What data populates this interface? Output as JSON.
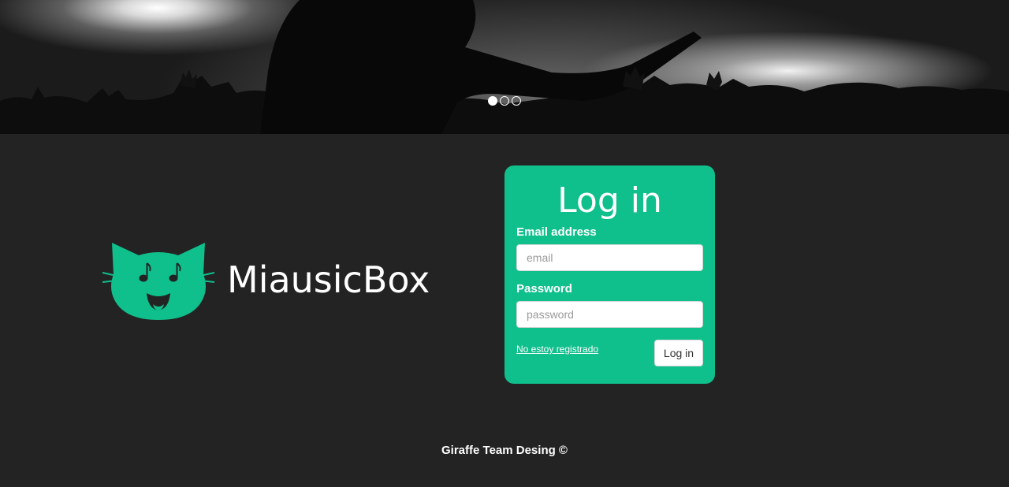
{
  "hero": {
    "slides": [
      "slide-1",
      "slide-2",
      "slide-3"
    ],
    "active_slide": 0
  },
  "brand": {
    "name": "MiausicBox",
    "color": "#0fbf8c"
  },
  "login": {
    "title": "Log in",
    "email_label": "Email address",
    "email_placeholder": "email",
    "email_value": "",
    "password_label": "Password",
    "password_placeholder": "password",
    "password_value": "",
    "register_link": "No estoy registrado",
    "submit_label": "Log in",
    "card_color": "#0fbf8c"
  },
  "footer": {
    "text": "Giraffe Team Desing ©"
  }
}
